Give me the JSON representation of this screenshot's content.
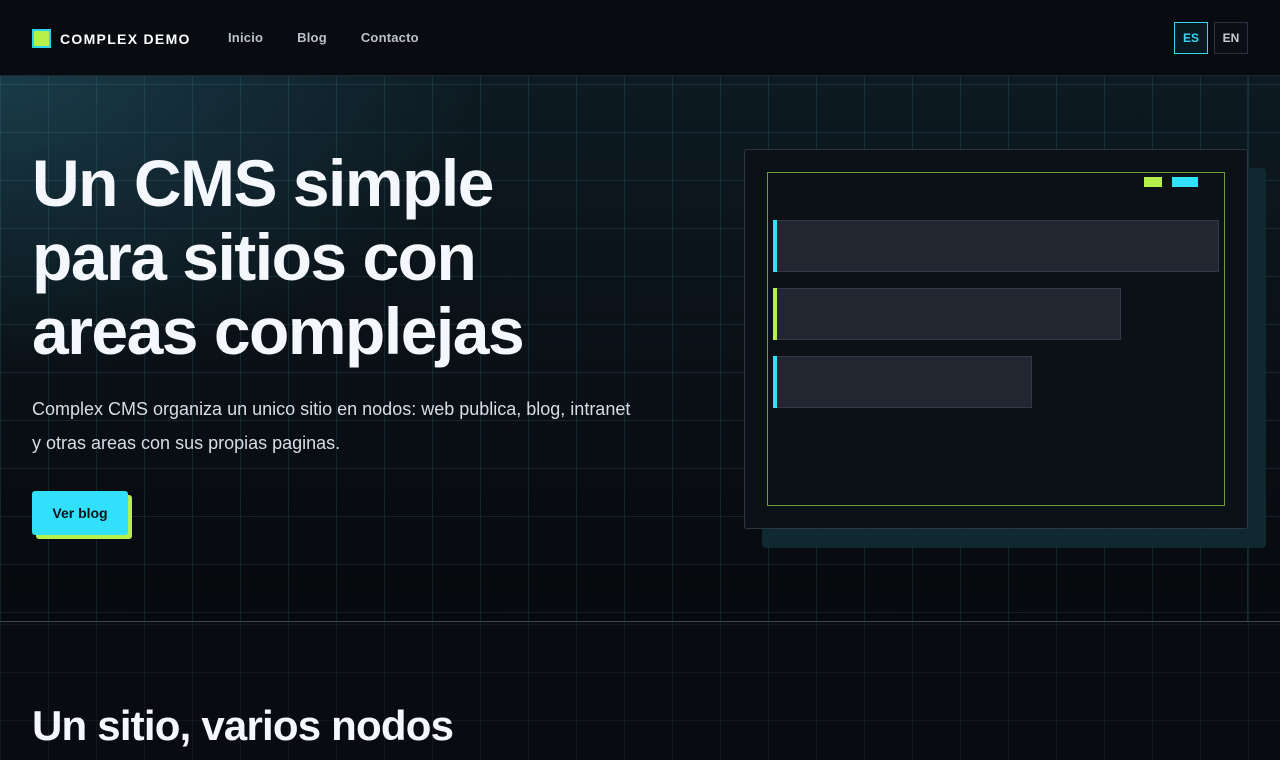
{
  "header": {
    "brand": "COMPLEX DEMO",
    "nav": [
      {
        "label": "Inicio"
      },
      {
        "label": "Blog"
      },
      {
        "label": "Contacto"
      }
    ],
    "languages": [
      {
        "label": "ES",
        "active": true
      },
      {
        "label": "EN",
        "active": false
      }
    ]
  },
  "hero": {
    "headline_lines": [
      "Un CMS simple",
      "para sitios con",
      "areas complejas"
    ],
    "subtitle_lines": [
      "Complex CMS organiza un unico sitio en nodos: web publica, blog, intranet",
      "y otras areas con sus propias paginas."
    ],
    "cta_label": "Ver blog"
  },
  "section": {
    "title": "Un sitio, varios nodos"
  },
  "colors": {
    "accent_cyan": "#33e0fb",
    "accent_lime": "#b6f04a",
    "background": "#06090d"
  }
}
